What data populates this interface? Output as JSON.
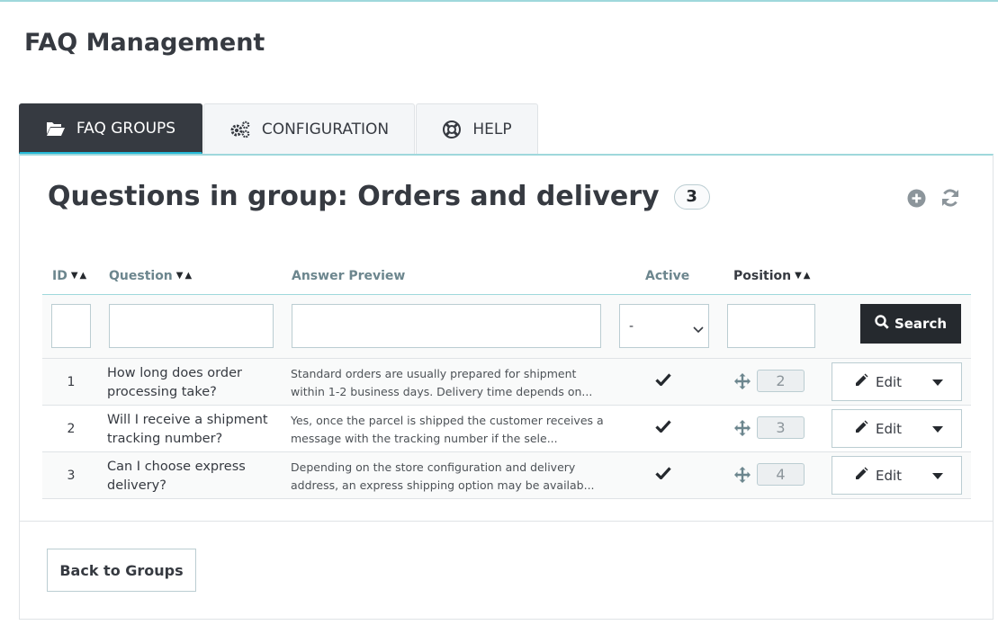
{
  "page": {
    "title": "FAQ Management"
  },
  "tabs": [
    {
      "label": "FAQ GROUPS",
      "icon": "folder-open-icon",
      "active": true
    },
    {
      "label": "CONFIGURATION",
      "icon": "cogs-icon",
      "active": false
    },
    {
      "label": "HELP",
      "icon": "life-ring-icon",
      "active": false
    }
  ],
  "panel": {
    "title": "Questions in group: Orders and delivery",
    "count": "3",
    "actions": [
      "add-new-icon",
      "refresh-icon"
    ]
  },
  "table": {
    "headers": {
      "id": "ID",
      "question": "Question",
      "answer": "Answer Preview",
      "active": "Active",
      "position": "Position"
    },
    "filters": {
      "id": "",
      "question": "",
      "answer": "",
      "active_selected": "-",
      "position": ""
    },
    "search_label": "Search",
    "rows": [
      {
        "id": "1",
        "question": "How long does order processing take?",
        "answer": "Standard orders are usually prepared for shipment within 1-2 business days. Delivery time depends on...",
        "active": true,
        "position": "2",
        "edit_label": "Edit"
      },
      {
        "id": "2",
        "question": "Will I receive a shipment tracking number?",
        "answer": "Yes, once the parcel is shipped the customer receives a message with the tracking number if the sele...",
        "active": true,
        "position": "3",
        "edit_label": "Edit"
      },
      {
        "id": "3",
        "question": "Can I choose express delivery?",
        "answer": "Depending on the store configuration and delivery address, an express shipping option may be availab...",
        "active": true,
        "position": "4",
        "edit_label": "Edit"
      }
    ]
  },
  "footer": {
    "back_label": "Back to Groups"
  },
  "colors": {
    "accent": "#25b9d7",
    "dark": "#363a41",
    "border": "#bbcdd2"
  }
}
